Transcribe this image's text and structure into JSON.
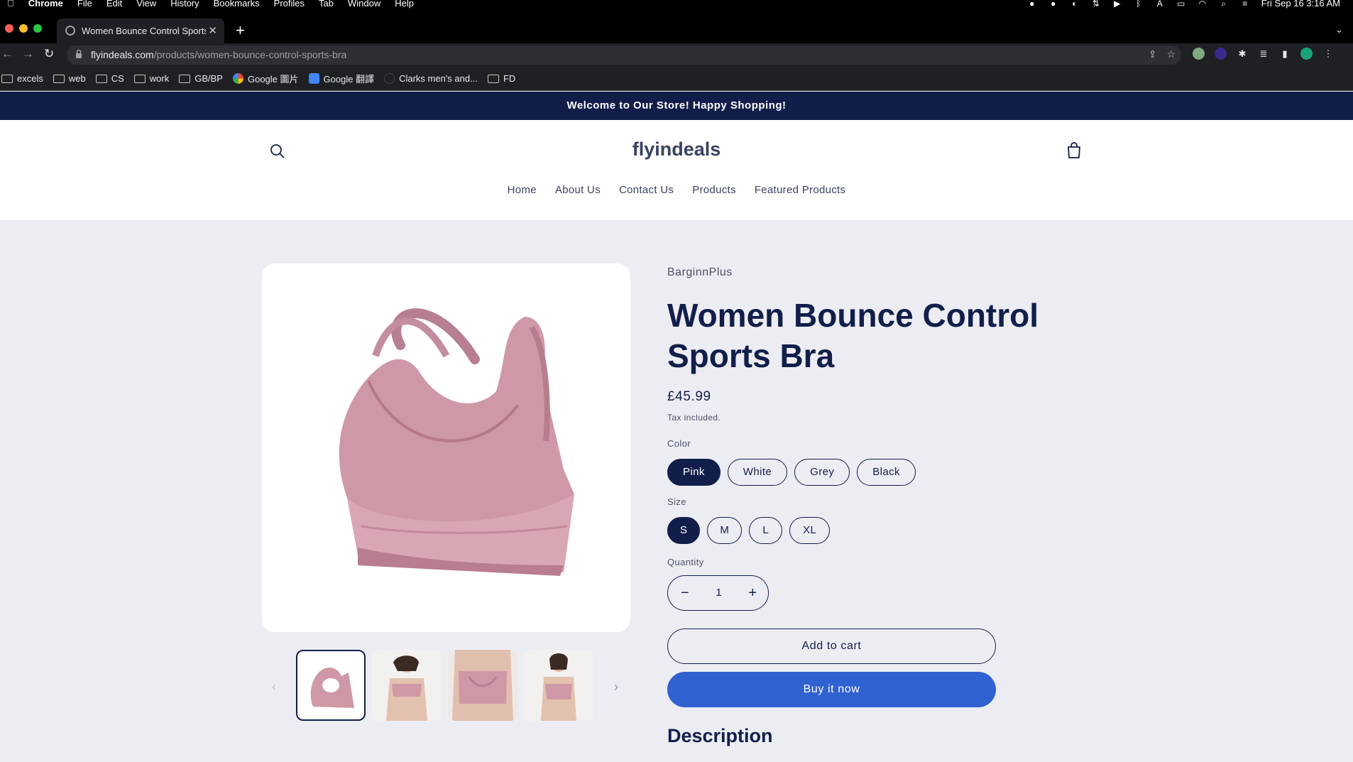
{
  "menubar": {
    "app": "Chrome",
    "menus": [
      "File",
      "Edit",
      "View",
      "History",
      "Bookmarks",
      "Profiles",
      "Tab",
      "Window",
      "Help"
    ],
    "clock": "Fri Sep 16  3:16 AM"
  },
  "tab": {
    "title": "Women Bounce Control Sports",
    "close": "✕",
    "new": "+"
  },
  "address": {
    "domain": "flyindeals.com",
    "path": "/products/women-bounce-control-sports-bra"
  },
  "bookmarks": [
    {
      "label": "excels",
      "type": "folder"
    },
    {
      "label": "web",
      "type": "folder"
    },
    {
      "label": "CS",
      "type": "folder"
    },
    {
      "label": "work",
      "type": "folder"
    },
    {
      "label": "GB/BP",
      "type": "folder"
    },
    {
      "label": "Google 圖片",
      "type": "google"
    },
    {
      "label": "Google 翻譯",
      "type": "translate"
    },
    {
      "label": "Clarks men's and...",
      "type": "site"
    },
    {
      "label": "FD",
      "type": "folder"
    }
  ],
  "announcement": "Welcome to Our Store! Happy Shopping!",
  "store": {
    "logo": "flyindeals",
    "nav": [
      "Home",
      "About Us",
      "Contact Us",
      "Products",
      "Featured Products"
    ]
  },
  "product": {
    "vendor": "BarginnPlus",
    "title": "Women Bounce Control Sports Bra",
    "price": "£45.99",
    "tax_note": "Tax included.",
    "color_label": "Color",
    "colors": [
      "Pink",
      "White",
      "Grey",
      "Black"
    ],
    "selected_color": "Pink",
    "size_label": "Size",
    "sizes": [
      "S",
      "M",
      "L",
      "XL"
    ],
    "selected_size": "S",
    "quantity_label": "Quantity",
    "quantity": "1",
    "minus": "−",
    "plus": "+",
    "add_to_cart": "Add to cart",
    "buy_now": "Buy it now",
    "description_heading": "Description"
  },
  "colors": {
    "announcement_bg": "#121e4a",
    "brand_navy": "#121e4a",
    "buy_button": "#3061d0",
    "product_pink": "#c9909f"
  }
}
